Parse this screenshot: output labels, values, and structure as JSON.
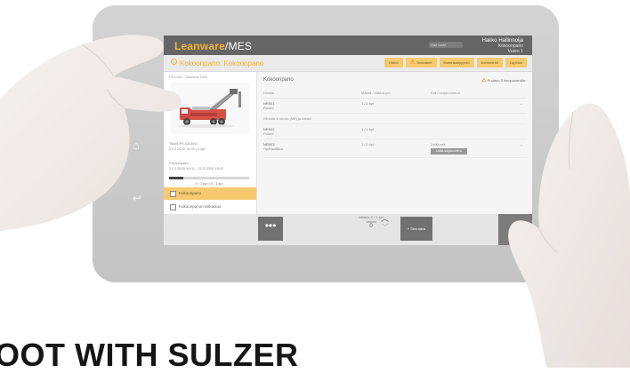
{
  "app": {
    "logo_brand": "Leanware",
    "logo_product": "MES",
    "page_title": "Kokoonpano: Kokoonpano",
    "search_placeholder": "Hae tuote",
    "user_name": "Hakko Hallinnoija",
    "user_line2": "Kokoonpano",
    "user_line3": "Vuoro 1"
  },
  "toolbar": {
    "buttons": [
      "Häiriö",
      "Tiedotteet",
      "Materiaalipyyntö",
      "Kommentti",
      "Lopetus"
    ],
    "warn_index": 1
  },
  "left_panel": {
    "breadcrumb": "PK1004 - Tilausrivi 1004",
    "order_label": "Tilaus PK1004001",
    "order_date": "21.3.2020 14:01 | 1 kpl",
    "work_phase": "Kokoonpano",
    "work_time": "21.3.2020 14:01 - 21.3.2020 15:01",
    "progress": 0.18,
    "progress_text": "0 / 1 kpl | 0 / 1 kpl",
    "tasks": [
      {
        "label": "Kokoonpano",
        "active": true
      },
      {
        "label": "Kokoonpanon tarkastus",
        "active": false
      }
    ]
  },
  "main": {
    "title": "Kokoonpano",
    "warning": "Puuttuu 3 komponenttia",
    "columns": [
      "Nimike",
      "Määrä / Määrä yht.",
      "Erä / sarjanumerot"
    ],
    "rows": [
      {
        "code": "NR501",
        "name": "Runko",
        "qty": "1 / 1 kpl",
        "serial": ""
      },
      {
        "subheader": "Kiinnitä 4 ruuvia (M8) ja kiristä"
      },
      {
        "code": "NR502",
        "name": "Puomi",
        "qty": "1 / 1 kpl",
        "serial": ""
      },
      {
        "code": "NR503",
        "name": "Hydrauliikka",
        "qty": "1 / 1 kpl",
        "serial": "Lisää erä",
        "button": "Lisää sarjanumero"
      }
    ]
  },
  "bottom": {
    "more": "•••",
    "qty_label": "Määrä: 0 / 1 kpl",
    "qty_sub": "Valmiit",
    "qty_value": "0",
    "next": "Seuraava",
    "done": "Valmis"
  },
  "slogan": "OOT WITH SULZER",
  "colors": {
    "accent": "#f0a81e",
    "header": "#505050",
    "active_task": "#f6c35c"
  }
}
